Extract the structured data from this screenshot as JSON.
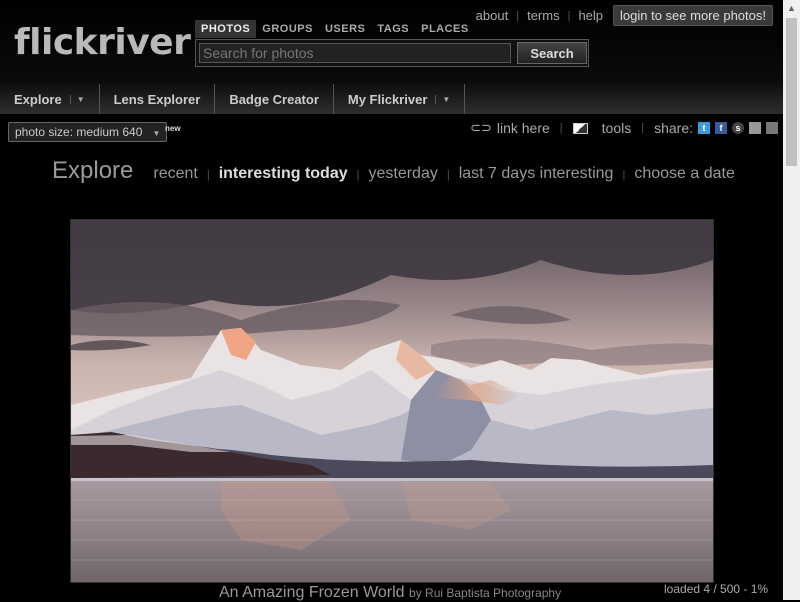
{
  "logo": "flickriver",
  "search": {
    "tabs": [
      "PHOTOS",
      "GROUPS",
      "USERS",
      "TAGS",
      "PLACES"
    ],
    "placeholder": "Search for photos",
    "button": "Search"
  },
  "top_links": [
    "about",
    "terms",
    "help"
  ],
  "login_button": "login to see more photos!",
  "nav": [
    "Explore",
    "Lens Explorer",
    "Badge Creator",
    "My Flickriver"
  ],
  "toolbar": {
    "photo_size": "photo size: medium 640",
    "new_badge": "new",
    "link_here": "link here",
    "tools": "tools",
    "share": "share:"
  },
  "explore": {
    "title": "Explore",
    "links": [
      "recent",
      "interesting today",
      "yesterday",
      "last 7 days interesting",
      "choose a date"
    ],
    "active_link": "interesting today"
  },
  "photo": {
    "title": "An Amazing Frozen World",
    "by": "by Rui Baptista Photography"
  },
  "status": "loaded 4 / 500 - 1%",
  "colors": {
    "background": "#000000",
    "header_gradient_end": "#2e2e2e",
    "active_text": "#dddddd"
  },
  "icons": [
    "link-icon",
    "tools-icon",
    "twitter-icon",
    "facebook-icon",
    "stumbleupon-icon",
    "delicious-icon",
    "puzzle-icon"
  ]
}
